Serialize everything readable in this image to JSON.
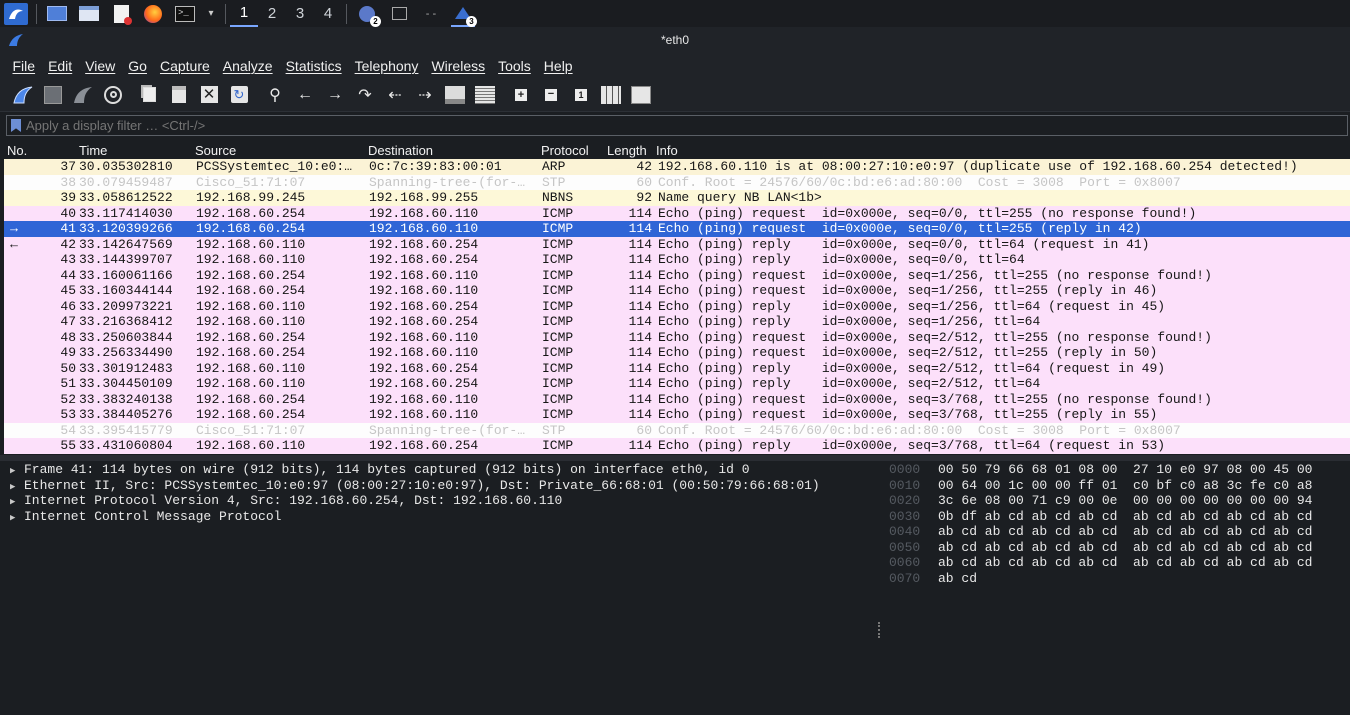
{
  "taskbar": {
    "workspaces": [
      "1",
      "2",
      "3",
      "4"
    ],
    "badges": {
      "chat": "2",
      "wireshark": "3"
    }
  },
  "window": {
    "title": "*eth0"
  },
  "menu": [
    "File",
    "Edit",
    "View",
    "Go",
    "Capture",
    "Analyze",
    "Statistics",
    "Telephony",
    "Wireless",
    "Tools",
    "Help"
  ],
  "filter": {
    "placeholder": "Apply a display filter … <Ctrl-/>"
  },
  "columns": {
    "no": "No.",
    "time": "Time",
    "source": "Source",
    "destination": "Destination",
    "protocol": "Protocol",
    "length": "Length",
    "info": "Info"
  },
  "packets": [
    {
      "arrow": "",
      "no": "37",
      "time": "30.035302810",
      "src": "PCSSystemtec_10:e0:…",
      "dst": "0c:7c:39:83:00:01",
      "proto": "ARP",
      "len": "42",
      "info": "192.168.60.110 is at 08:00:27:10:e0:97 (duplicate use of 192.168.60.254 detected!)",
      "kind": "arp"
    },
    {
      "arrow": "",
      "no": "38",
      "time": "30.079459487",
      "src": "Cisco_51:71:07",
      "dst": "Spanning-tree-(for-…",
      "proto": "STP",
      "len": "60",
      "info": "Conf. Root = 24576/60/0c:bd:e6:ad:80:00  Cost = 3008  Port = 0x8007",
      "kind": "stp"
    },
    {
      "arrow": "",
      "no": "39",
      "time": "33.058612522",
      "src": "192.168.99.245",
      "dst": "192.168.99.255",
      "proto": "NBNS",
      "len": "92",
      "info": "Name query NB LAN<1b>",
      "kind": "nbns"
    },
    {
      "arrow": "",
      "no": "40",
      "time": "33.117414030",
      "src": "192.168.60.254",
      "dst": "192.168.60.110",
      "proto": "ICMP",
      "len": "114",
      "info": "Echo (ping) request  id=0x000e, seq=0/0, ttl=255 (no response found!)",
      "kind": "icmp"
    },
    {
      "arrow": "→",
      "no": "41",
      "time": "33.120399266",
      "src": "192.168.60.254",
      "dst": "192.168.60.110",
      "proto": "ICMP",
      "len": "114",
      "info": "Echo (ping) request  id=0x000e, seq=0/0, ttl=255 (reply in 42)",
      "kind": "selected"
    },
    {
      "arrow": "←",
      "no": "42",
      "time": "33.142647569",
      "src": "192.168.60.110",
      "dst": "192.168.60.254",
      "proto": "ICMP",
      "len": "114",
      "info": "Echo (ping) reply    id=0x000e, seq=0/0, ttl=64 (request in 41)",
      "kind": "icmp"
    },
    {
      "arrow": "",
      "no": "43",
      "time": "33.144399707",
      "src": "192.168.60.110",
      "dst": "192.168.60.254",
      "proto": "ICMP",
      "len": "114",
      "info": "Echo (ping) reply    id=0x000e, seq=0/0, ttl=64",
      "kind": "icmp"
    },
    {
      "arrow": "",
      "no": "44",
      "time": "33.160061166",
      "src": "192.168.60.254",
      "dst": "192.168.60.110",
      "proto": "ICMP",
      "len": "114",
      "info": "Echo (ping) request  id=0x000e, seq=1/256, ttl=255 (no response found!)",
      "kind": "icmp"
    },
    {
      "arrow": "",
      "no": "45",
      "time": "33.160344144",
      "src": "192.168.60.254",
      "dst": "192.168.60.110",
      "proto": "ICMP",
      "len": "114",
      "info": "Echo (ping) request  id=0x000e, seq=1/256, ttl=255 (reply in 46)",
      "kind": "icmp"
    },
    {
      "arrow": "",
      "no": "46",
      "time": "33.209973221",
      "src": "192.168.60.110",
      "dst": "192.168.60.254",
      "proto": "ICMP",
      "len": "114",
      "info": "Echo (ping) reply    id=0x000e, seq=1/256, ttl=64 (request in 45)",
      "kind": "icmp"
    },
    {
      "arrow": "",
      "no": "47",
      "time": "33.216368412",
      "src": "192.168.60.110",
      "dst": "192.168.60.254",
      "proto": "ICMP",
      "len": "114",
      "info": "Echo (ping) reply    id=0x000e, seq=1/256, ttl=64",
      "kind": "icmp"
    },
    {
      "arrow": "",
      "no": "48",
      "time": "33.250603844",
      "src": "192.168.60.254",
      "dst": "192.168.60.110",
      "proto": "ICMP",
      "len": "114",
      "info": "Echo (ping) request  id=0x000e, seq=2/512, ttl=255 (no response found!)",
      "kind": "icmp"
    },
    {
      "arrow": "",
      "no": "49",
      "time": "33.256334490",
      "src": "192.168.60.254",
      "dst": "192.168.60.110",
      "proto": "ICMP",
      "len": "114",
      "info": "Echo (ping) request  id=0x000e, seq=2/512, ttl=255 (reply in 50)",
      "kind": "icmp"
    },
    {
      "arrow": "",
      "no": "50",
      "time": "33.301912483",
      "src": "192.168.60.110",
      "dst": "192.168.60.254",
      "proto": "ICMP",
      "len": "114",
      "info": "Echo (ping) reply    id=0x000e, seq=2/512, ttl=64 (request in 49)",
      "kind": "icmp"
    },
    {
      "arrow": "",
      "no": "51",
      "time": "33.304450109",
      "src": "192.168.60.110",
      "dst": "192.168.60.254",
      "proto": "ICMP",
      "len": "114",
      "info": "Echo (ping) reply    id=0x000e, seq=2/512, ttl=64",
      "kind": "icmp"
    },
    {
      "arrow": "",
      "no": "52",
      "time": "33.383240138",
      "src": "192.168.60.254",
      "dst": "192.168.60.110",
      "proto": "ICMP",
      "len": "114",
      "info": "Echo (ping) request  id=0x000e, seq=3/768, ttl=255 (no response found!)",
      "kind": "icmp"
    },
    {
      "arrow": "",
      "no": "53",
      "time": "33.384405276",
      "src": "192.168.60.254",
      "dst": "192.168.60.110",
      "proto": "ICMP",
      "len": "114",
      "info": "Echo (ping) request  id=0x000e, seq=3/768, ttl=255 (reply in 55)",
      "kind": "icmp"
    },
    {
      "arrow": "",
      "no": "54",
      "time": "33.395415779",
      "src": "Cisco_51:71:07",
      "dst": "Spanning-tree-(for-…",
      "proto": "STP",
      "len": "60",
      "info": "Conf. Root = 24576/60/0c:bd:e6:ad:80:00  Cost = 3008  Port = 0x8007",
      "kind": "stp"
    },
    {
      "arrow": "",
      "no": "55",
      "time": "33.431060804",
      "src": "192.168.60.110",
      "dst": "192.168.60.254",
      "proto": "ICMP",
      "len": "114",
      "info": "Echo (ping) reply    id=0x000e, seq=3/768, ttl=64 (request in 53)",
      "kind": "icmp"
    }
  ],
  "details": [
    "Frame 41: 114 bytes on wire (912 bits), 114 bytes captured (912 bits) on interface eth0, id 0",
    "Ethernet II, Src: PCSSystemtec_10:e0:97 (08:00:27:10:e0:97), Dst: Private_66:68:01 (00:50:79:66:68:01)",
    "Internet Protocol Version 4, Src: 192.168.60.254, Dst: 192.168.60.110",
    "Internet Control Message Protocol"
  ],
  "bytes": [
    {
      "offset": "0000",
      "hex": "00 50 79 66 68 01 08 00  27 10 e0 97 08 00 45 00"
    },
    {
      "offset": "0010",
      "hex": "00 64 00 1c 00 00 ff 01  c0 bf c0 a8 3c fe c0 a8"
    },
    {
      "offset": "0020",
      "hex": "3c 6e 08 00 71 c9 00 0e  00 00 00 00 00 00 00 94"
    },
    {
      "offset": "0030",
      "hex": "0b df ab cd ab cd ab cd  ab cd ab cd ab cd ab cd"
    },
    {
      "offset": "0040",
      "hex": "ab cd ab cd ab cd ab cd  ab cd ab cd ab cd ab cd"
    },
    {
      "offset": "0050",
      "hex": "ab cd ab cd ab cd ab cd  ab cd ab cd ab cd ab cd"
    },
    {
      "offset": "0060",
      "hex": "ab cd ab cd ab cd ab cd  ab cd ab cd ab cd ab cd"
    },
    {
      "offset": "0070",
      "hex": "ab cd"
    }
  ]
}
